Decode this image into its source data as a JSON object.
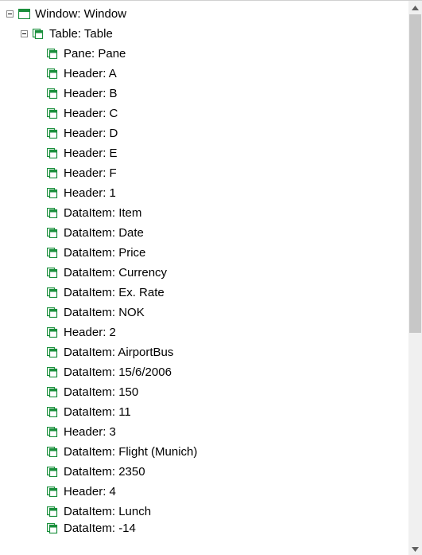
{
  "tree": {
    "root": {
      "label": "Window: Window",
      "icon": "window-icon",
      "expanded": true,
      "children": [
        {
          "label": "Table: Table",
          "icon": "pane-icon",
          "expanded": true,
          "children": [
            {
              "label": "Pane: Pane",
              "icon": "pane-icon"
            },
            {
              "label": "Header: A",
              "icon": "pane-icon"
            },
            {
              "label": "Header: B",
              "icon": "pane-icon"
            },
            {
              "label": "Header: C",
              "icon": "pane-icon"
            },
            {
              "label": "Header: D",
              "icon": "pane-icon"
            },
            {
              "label": "Header: E",
              "icon": "pane-icon"
            },
            {
              "label": "Header: F",
              "icon": "pane-icon"
            },
            {
              "label": "Header: 1",
              "icon": "pane-icon"
            },
            {
              "label": "DataItem: Item",
              "icon": "pane-icon"
            },
            {
              "label": "DataItem: Date",
              "icon": "pane-icon"
            },
            {
              "label": "DataItem: Price",
              "icon": "pane-icon"
            },
            {
              "label": "DataItem: Currency",
              "icon": "pane-icon"
            },
            {
              "label": "DataItem: Ex. Rate",
              "icon": "pane-icon"
            },
            {
              "label": "DataItem: NOK",
              "icon": "pane-icon"
            },
            {
              "label": "Header: 2",
              "icon": "pane-icon"
            },
            {
              "label": "DataItem: AirportBus",
              "icon": "pane-icon"
            },
            {
              "label": "DataItem: 15/6/2006",
              "icon": "pane-icon"
            },
            {
              "label": "DataItem: 150",
              "icon": "pane-icon"
            },
            {
              "label": "DataItem: 11",
              "icon": "pane-icon"
            },
            {
              "label": "Header: 3",
              "icon": "pane-icon"
            },
            {
              "label": "DataItem: Flight (Munich)",
              "icon": "pane-icon"
            },
            {
              "label": "DataItem: 2350",
              "icon": "pane-icon"
            },
            {
              "label": "Header: 4",
              "icon": "pane-icon"
            },
            {
              "label": "DataItem: Lunch",
              "icon": "pane-icon"
            },
            {
              "label": "DataItem: -14",
              "icon": "pane-icon",
              "cut": true
            }
          ]
        }
      ]
    }
  },
  "colors": {
    "icon_green": "#1a8f3c",
    "toggle_stroke": "#888888"
  }
}
